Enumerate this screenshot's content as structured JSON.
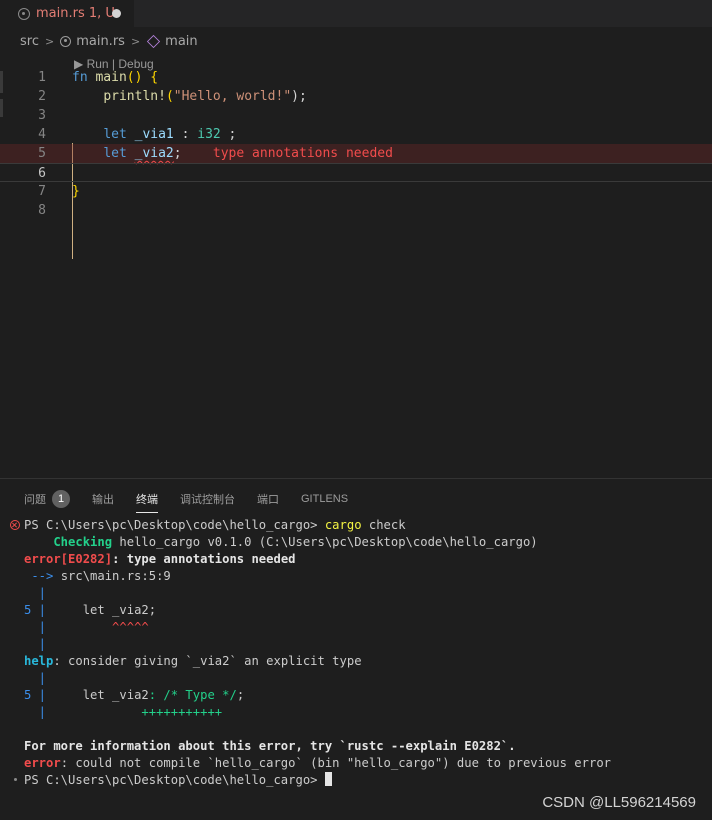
{
  "tab": {
    "title": "main.rs 1, U"
  },
  "breadcrumb": {
    "folder": "src",
    "file": "main.rs",
    "symbol": "main"
  },
  "editor": {
    "codelens": "▶ Run | Debug",
    "line_numbers": [
      "1",
      "2",
      "3",
      "4",
      "5",
      "6",
      "7",
      "8"
    ],
    "line1": {
      "kw": "fn",
      "name": "main",
      "parens": "()",
      "brace": "{"
    },
    "line2": {
      "macro": "println!",
      "open": "(",
      "str": "\"Hello, world!\"",
      "close": ");"
    },
    "line4": {
      "kw": "let",
      "var": "_via1",
      "colon": " : ",
      "type": "i32",
      "end": " ;"
    },
    "line5": {
      "kw": "let",
      "var": "_via2",
      "end": ";",
      "error": "type annotations needed"
    },
    "line7": {
      "brace": "}"
    }
  },
  "panel": {
    "tabs": [
      {
        "label": "问题"
      },
      {
        "label": "输出"
      },
      {
        "label": "终端"
      },
      {
        "label": "调试控制台"
      },
      {
        "label": "端口"
      },
      {
        "label": "GITLENS"
      }
    ],
    "problems_count": "1"
  },
  "terminal": {
    "l1_prompt": "PS C:\\Users\\pc\\Desktop\\code\\hello_cargo> ",
    "l1_cmd": "cargo",
    "l1_arg": " check",
    "l2_status": "    Checking",
    "l2_rest": " hello_cargo v0.1.0 (C:\\Users\\pc\\Desktop\\code\\hello_cargo)",
    "l3_code": "error[E0282]",
    "l3_msg": ": type annotations needed",
    "l4_arrow": " --> ",
    "l4_loc": "src\\main.rs:5:9",
    "l5_bar": "  |",
    "l6_num": "5 |",
    "l6_code": "     let _via2;",
    "l7_bar": "  |",
    "l7_carets": "         ^^^^^",
    "l8_bar": "  |",
    "l9_help": "help",
    "l9_msg": ": consider giving `_via2` an explicit type",
    "l10_bar": "  |",
    "l11_num": "5 |",
    "l11_code": "     let _via2",
    "l11_hint": ": /* Type */",
    "l11_end": ";",
    "l12_bar": "  |",
    "l12_plus": "             +++++++++++",
    "l13_info": "For more information about this error, try `rustc --explain E0282`.",
    "l14_err": "error",
    "l14_msg": ": could not compile `hello_cargo` (bin \"hello_cargo\") due to previous error",
    "l15_prompt": "PS C:\\Users\\pc\\Desktop\\code\\hello_cargo> "
  },
  "watermark": "CSDN @LL596214569"
}
